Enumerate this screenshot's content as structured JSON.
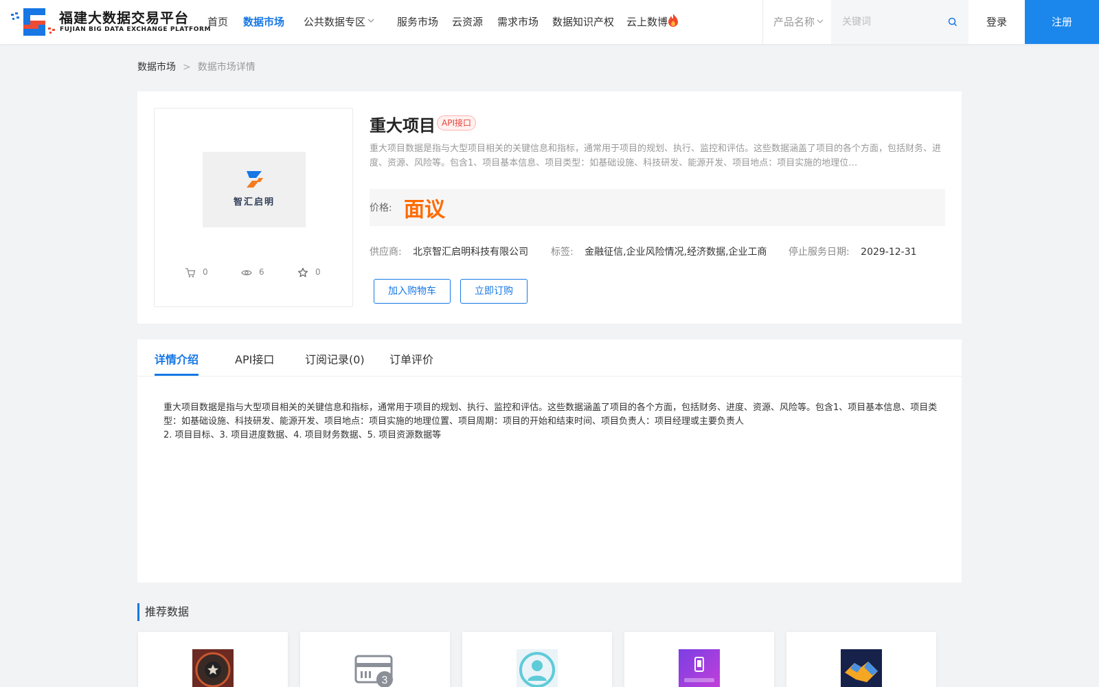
{
  "header": {
    "logo_cn": "福建大数据交易平台",
    "logo_en": "FUJIAN BIG DATA EXCHANGE  PLATFORM",
    "nav": [
      "首页",
      "数据市场",
      "公共数据专区",
      "服务市场",
      "云资源",
      "需求市场",
      "数据知识产权",
      "云上数博"
    ],
    "active_nav": "数据市场",
    "product_select": "产品名称",
    "search_placeholder": "关键词",
    "login": "登录",
    "register": "注册"
  },
  "breadcrumb": {
    "level1": "数据市场",
    "separator": ">",
    "level2": "数据市场详情"
  },
  "product": {
    "title": "重大项目",
    "badge": "API接口",
    "thumb_text": "智汇启明",
    "description": "重大项目数据是指与大型项目相关的关键信息和指标，通常用于项目的规划、执行、监控和评估。这些数据涵盖了项目的各个方面，包括财务、进度、资源、风险等。包含1、项目基本信息、项目类型：如基础设施、科技研发、能源开发、项目地点：项目实施的地理位…",
    "price_label": "价格:",
    "price_value": "面议",
    "supplier_label": "供应商:",
    "supplier": "北京智汇启明科技有限公司",
    "tags_label": "标签:",
    "tags": "金融征信,企业风险情况,经济数据,企业工商",
    "end_date_label": "停止服务日期:",
    "end_date": "2029-12-31",
    "stats": {
      "cart": "0",
      "views": "6",
      "favorites": "0"
    },
    "add_cart": "加入购物车",
    "subscribe": "立即订购"
  },
  "tabs": [
    "详情介绍",
    "API接口",
    "订阅记录(0)",
    "订单评价"
  ],
  "active_tab": "详情介绍",
  "detail_text": "重大项目数据是指与大型项目相关的关键信息和指标，通常用于项目的规划、执行、监控和评估。这些数据涵盖了项目的各个方面，包括财务、进度、资源、风险等。包含1、项目基本信息、项目类型：如基础设施、科技研发、能源开发、项目地点：项目实施的地理位置、项目周期：项目的开始和结束时间、项目负责人：项目经理或主要负责人\n2. 项目目标、3. 项目进度数据、4. 项目财务数据、5. 项目资源数据等",
  "recommend": {
    "title": "推荐数据",
    "cards": [
      {
        "icon": "badge-star-icon"
      },
      {
        "icon": "card-number-icon"
      },
      {
        "icon": "person-circle-icon"
      },
      {
        "icon": "phone-verify-icon"
      },
      {
        "icon": "handshake-icon"
      }
    ]
  },
  "colors": {
    "brand": "#1677e5",
    "register_bg": "#1b87ec",
    "price": "#ff6a00",
    "badge": "#e8433a"
  }
}
